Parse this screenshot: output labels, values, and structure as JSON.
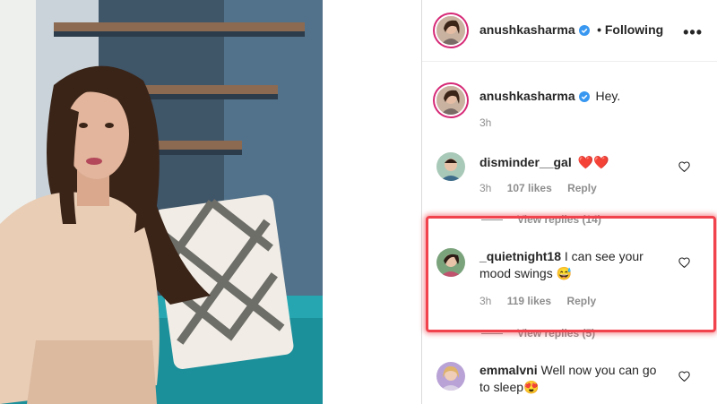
{
  "post": {
    "author": "anushkasharma",
    "follow_status": "• Following",
    "more_label": "•••"
  },
  "caption": {
    "username": "anushkasharma",
    "text": "Hey.",
    "time": "3h"
  },
  "comments": [
    {
      "username": "disminder__gal",
      "text": "❤️❤️",
      "time": "3h",
      "likes": "107 likes",
      "reply": "Reply",
      "view_replies": "View replies (14)"
    },
    {
      "username": "_quietnight18",
      "text": "I can see your mood swings 😅",
      "time": "3h",
      "likes": "119 likes",
      "reply": "Reply",
      "view_replies": "View replies (5)"
    },
    {
      "username": "emmalvni",
      "text": "Well now you can go to sleep😍"
    }
  ],
  "colors": {
    "highlight": "#f0434d",
    "verified": "#3897f0",
    "heart": "#e0245e"
  },
  "icons": {
    "verified": "verified-badge-icon",
    "like": "heart-outline-icon",
    "more": "more-options-icon"
  }
}
